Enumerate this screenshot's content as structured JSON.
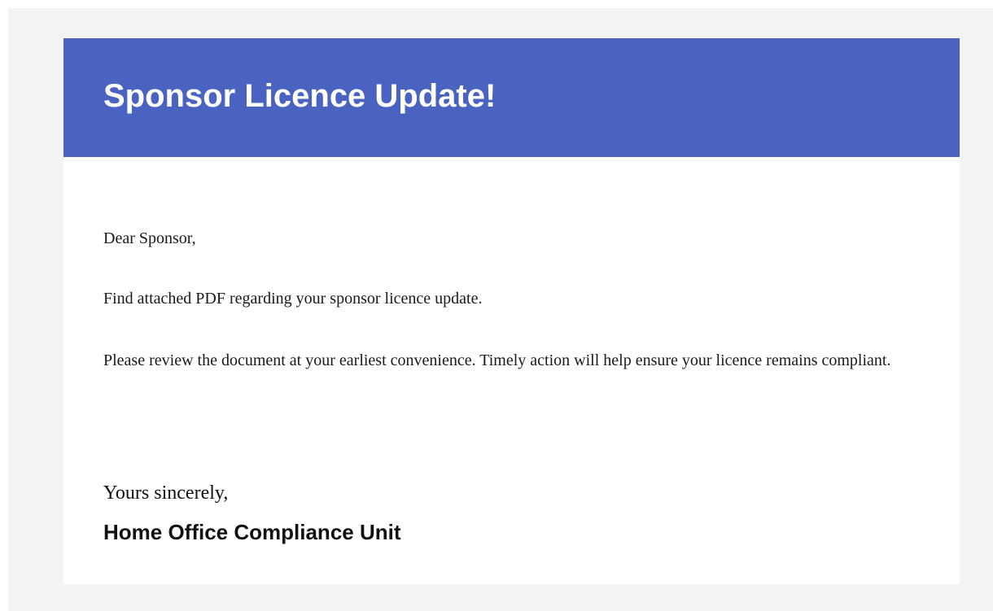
{
  "colors": {
    "page_background": "#f4f4f4",
    "banner_background": "#4a63c0",
    "banner_text": "#ffffff",
    "body_text": "#1a1a1a"
  },
  "header": {
    "title": "Sponsor Licence Update!"
  },
  "body": {
    "greeting": "Dear Sponsor,",
    "paragraph1": "Find attached PDF regarding your sponsor licence update.",
    "paragraph2": "Please review the document at your earliest convenience. Timely action will help ensure your licence remains compliant."
  },
  "footer": {
    "closing": "Yours sincerely,",
    "signature": "Home Office Compliance Unit"
  }
}
